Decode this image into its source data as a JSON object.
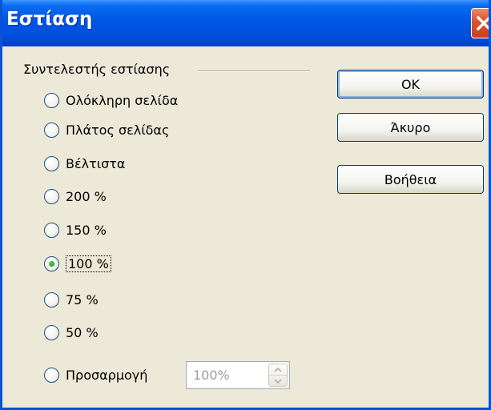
{
  "window": {
    "title": "Εστίαση"
  },
  "group": {
    "label": "Συντελεστής εστίασης"
  },
  "options": [
    {
      "label": "Ολόκληρη σελίδα",
      "selected": false
    },
    {
      "label": "Πλάτος σελίδας",
      "selected": false
    },
    {
      "label": "Βέλτιστα",
      "selected": false
    },
    {
      "label": "200 %",
      "selected": false
    },
    {
      "label": "150 %",
      "selected": false
    },
    {
      "label": "100 %",
      "selected": true
    },
    {
      "label": "75 %",
      "selected": false
    },
    {
      "label": "50 %",
      "selected": false
    },
    {
      "label": "Προσαρμογή",
      "selected": false
    }
  ],
  "custom": {
    "value": "100%"
  },
  "buttons": {
    "ok": "OK",
    "cancel": "Άκυρο",
    "help": "Βοήθεια"
  },
  "icons": {
    "close": "close-icon",
    "spin_up": "chevron-up-icon",
    "spin_down": "chevron-down-icon"
  },
  "colors": {
    "title_blue": "#0055e5",
    "close_red": "#dc5a36",
    "selected_green": "#21a121"
  }
}
